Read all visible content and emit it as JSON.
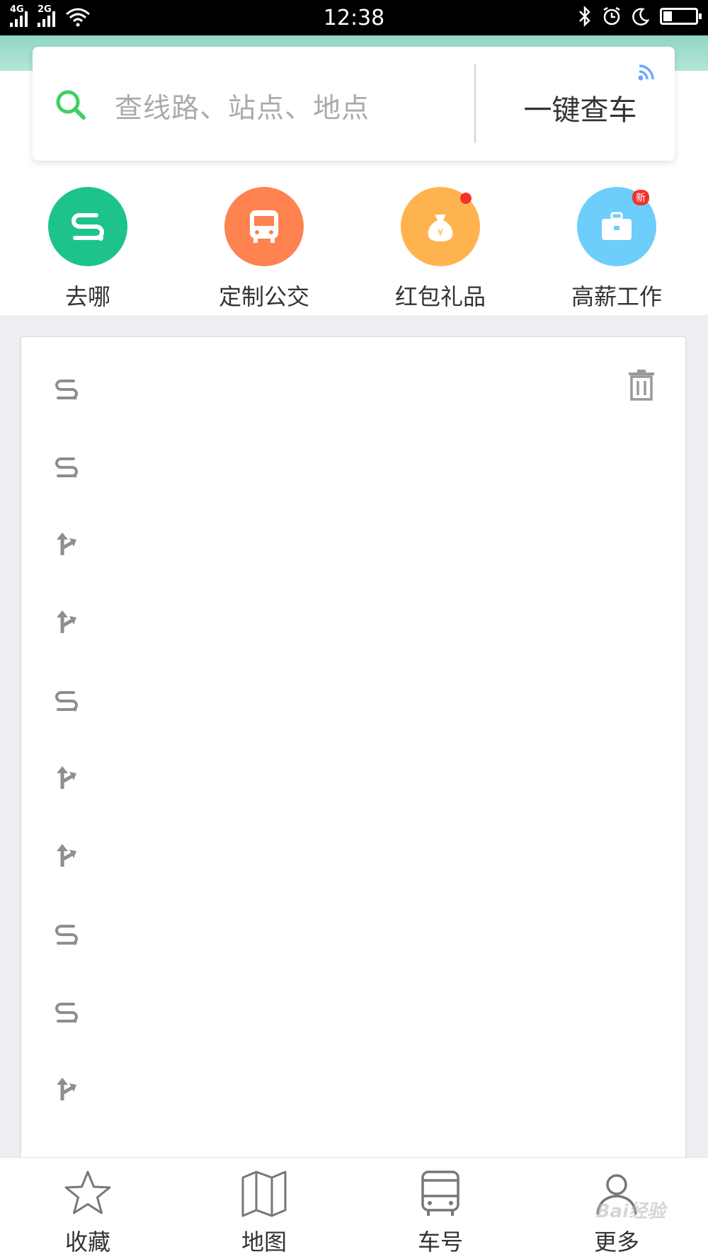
{
  "status_bar": {
    "time": "12:38",
    "network_1": "4G",
    "network_2": "2G",
    "battery_level": 0.25
  },
  "search": {
    "placeholder": "查线路、站点、地点",
    "quick_check_label": "一键查车"
  },
  "quick_actions": [
    {
      "label": "去哪",
      "icon": "route-icon",
      "color": "#1ec38a"
    },
    {
      "label": "定制公交",
      "icon": "bus-icon",
      "color": "#ff8251"
    },
    {
      "label": "红包礼品",
      "icon": "money-bag-icon",
      "color": "#ffb34f"
    },
    {
      "label": "高薪工作",
      "icon": "briefcase-icon",
      "color": "#6dcdfb",
      "badge": "新"
    }
  ],
  "history": {
    "items": [
      {
        "type": "route"
      },
      {
        "type": "route"
      },
      {
        "type": "turn"
      },
      {
        "type": "turn"
      },
      {
        "type": "route"
      },
      {
        "type": "turn"
      },
      {
        "type": "turn"
      },
      {
        "type": "route"
      },
      {
        "type": "route"
      },
      {
        "type": "turn"
      }
    ]
  },
  "bottom_nav": [
    {
      "label": "收藏",
      "icon": "star-icon"
    },
    {
      "label": "地图",
      "icon": "map-icon"
    },
    {
      "label": "车号",
      "icon": "bus-outline-icon"
    },
    {
      "label": "更多",
      "icon": "user-icon"
    }
  ],
  "watermark": "Bai经验"
}
